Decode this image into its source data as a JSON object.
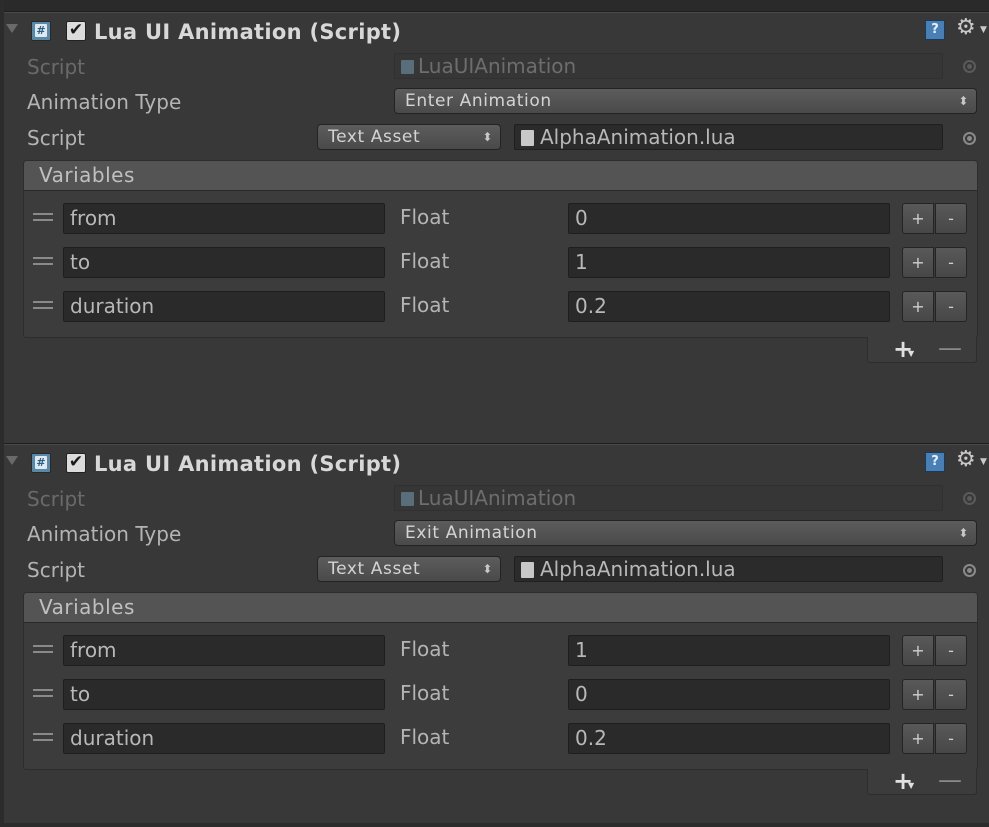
{
  "components": [
    {
      "title": "Lua UI Animation (Script)",
      "help_icon": "?",
      "script_label": "Script",
      "script_value": "LuaUIAnimation",
      "animation_type_label": "Animation Type",
      "animation_type_value": "Enter Animation",
      "lua_script_label": "Script",
      "lua_script_source": "Text Asset",
      "lua_script_file": "AlphaAnimation.lua",
      "variables_title": "Variables",
      "variables": [
        {
          "name": "from",
          "type": "Float",
          "value": "0"
        },
        {
          "name": "to",
          "type": "Float",
          "value": "1"
        },
        {
          "name": "duration",
          "type": "Float",
          "value": "0.2"
        }
      ]
    },
    {
      "title": "Lua UI Animation (Script)",
      "help_icon": "?",
      "script_label": "Script",
      "script_value": "LuaUIAnimation",
      "animation_type_label": "Animation Type",
      "animation_type_value": "Exit Animation",
      "lua_script_label": "Script",
      "lua_script_source": "Text Asset",
      "lua_script_file": "AlphaAnimation.lua",
      "variables_title": "Variables",
      "variables": [
        {
          "name": "from",
          "type": "Float",
          "value": "1"
        },
        {
          "name": "to",
          "type": "Float",
          "value": "0"
        },
        {
          "name": "duration",
          "type": "Float",
          "value": "0.2"
        }
      ]
    }
  ],
  "glyphs": {
    "check": "✔",
    "gear": "⚙",
    "caret": "▼",
    "popup_arrows": "⬍",
    "plus": "+",
    "minus": "-",
    "footer_plus": "+",
    "footer_minus": "—",
    "csharp": "#"
  },
  "colors": {
    "background": "#383838",
    "field": "#2b2b2b",
    "text": "#b4b4b4",
    "icon_blue": "#4a7fb5"
  }
}
